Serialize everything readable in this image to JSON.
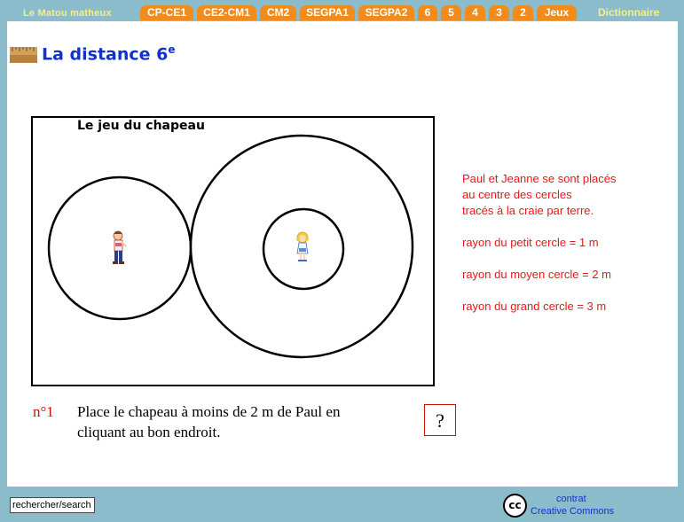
{
  "nav": {
    "brand": "Le Matou matheux",
    "tabs": [
      "CP-CE1",
      "CE2-CM1",
      "CM2",
      "SEGPA1",
      "SEGPA2",
      "6",
      "5",
      "4",
      "3",
      "2",
      "Jeux"
    ],
    "dictionary": "Dictionnaire",
    "tab_color": "#f08b1c",
    "brand_color": "#f7ee8a"
  },
  "page": {
    "title": "La distance 6",
    "title_sup": "e",
    "title_icon": "ruler-icon"
  },
  "game": {
    "title": "Le jeu du chapeau",
    "characters": [
      "paul-icon",
      "jeanne-icon"
    ]
  },
  "info": {
    "line1": "Paul et Jeanne se sont placés",
    "line2": "au centre des cercles",
    "line3": "tracés à la craie par terre.",
    "small_radius": "rayon du petit cercle = 1 m",
    "medium_radius": "rayon du moyen cercle = 2 m",
    "large_radius": "rayon du grand cercle = 3 m"
  },
  "question": {
    "number": "n°1",
    "line1": "Place le chapeau à moins de 2 m de Paul en",
    "line2": "cliquant au bon endroit.",
    "help": "?"
  },
  "footer": {
    "search_value": "rechercher/search",
    "cc": "cc",
    "license_line1": "contrat",
    "license_line2": "Creative Commons"
  }
}
